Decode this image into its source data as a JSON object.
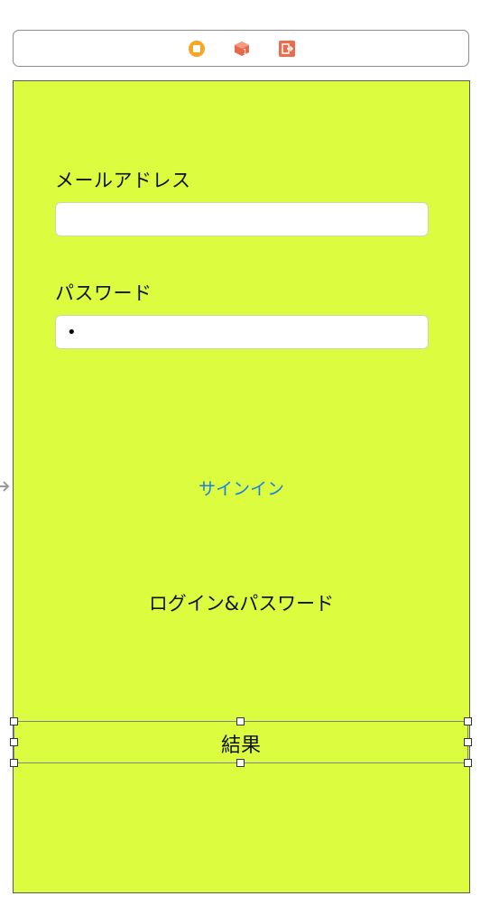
{
  "scene_dock": {
    "icons": [
      "view-controller-icon",
      "first-responder-icon",
      "exit-icon"
    ],
    "colors": {
      "vc": "#f5a623",
      "responder": "#e8684a",
      "exit": "#ee6b4d"
    }
  },
  "form": {
    "email_label": "メールアドレス",
    "email_value": "",
    "password_label": "パスワード",
    "password_value": "•"
  },
  "signin_button_label": "サインイン",
  "login_label": "ログイン&パスワード",
  "result_label": "結果",
  "colors": {
    "background": "#dcfd3f",
    "link": "#1b7ee6"
  }
}
